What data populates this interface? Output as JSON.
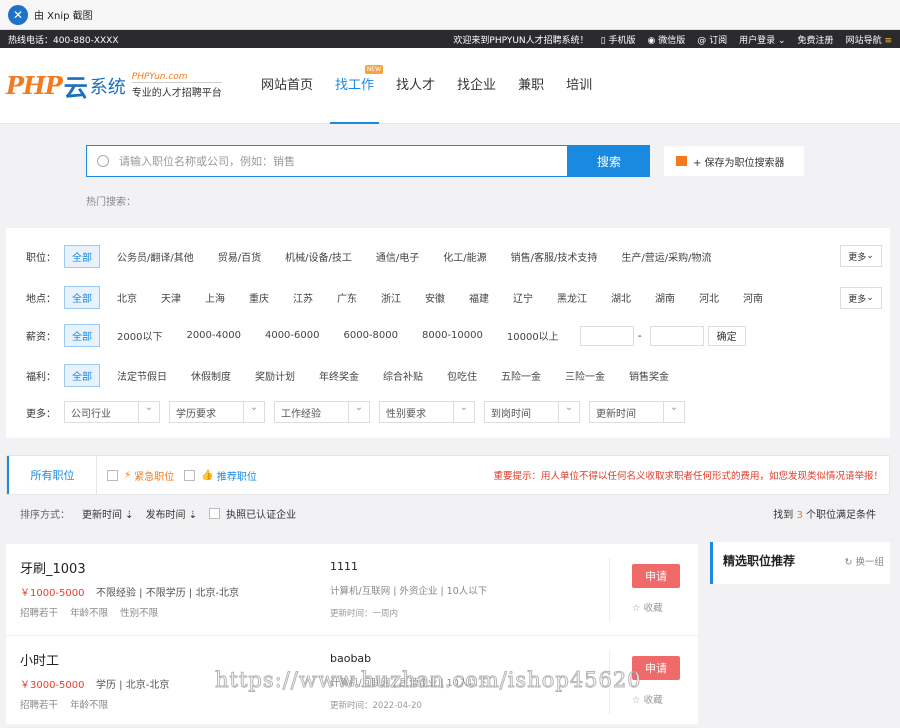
{
  "window_title": "由 Xnip 截图",
  "topbar": {
    "hotline": "热线电话：400-880-XXXX",
    "welcome": "欢迎来到PHPYUN人才招聘系统！",
    "mobile": "手机版",
    "wechat": "微信版",
    "subscribe": "订阅",
    "login": "用户登录",
    "register": "免费注册",
    "sitenav": "网站导航"
  },
  "brand": {
    "php": "PHP",
    "yun": "云",
    "xt": "系统",
    "domain": "PHPYun.com",
    "slogan": "专业的人才招聘平台"
  },
  "nav": {
    "items": [
      "网站首页",
      "找工作",
      "找人才",
      "找企业",
      "兼职",
      "培训"
    ],
    "new_badge": "NEW"
  },
  "search": {
    "placeholder": "请输入职位名称或公司，例如：销售",
    "button": "搜索",
    "save": "+ 保存为职位搜索器",
    "hot": "热门搜索："
  },
  "filters": {
    "job_label": "职位：",
    "job_opts": [
      "全部",
      "公务员/翻译/其他",
      "贸易/百货",
      "机械/设备/技工",
      "通信/电子",
      "化工/能源",
      "销售/客服/技术支持",
      "生产/营运/采购/物流"
    ],
    "loc_label": "地点：",
    "loc_opts": [
      "全部",
      "北京",
      "天津",
      "上海",
      "重庆",
      "江苏",
      "广东",
      "浙江",
      "安徽",
      "福建",
      "辽宁",
      "黑龙江",
      "湖北",
      "湖南",
      "河北",
      "河南"
    ],
    "sal_label": "薪资：",
    "sal_opts": [
      "全部",
      "2000以下",
      "2000-4000",
      "4000-6000",
      "6000-8000",
      "8000-10000",
      "10000以上"
    ],
    "sal_dash": "-",
    "confirm": "确定",
    "wel_label": "福利：",
    "wel_opts": [
      "全部",
      "法定节假日",
      "休假制度",
      "奖励计划",
      "年终奖金",
      "综合补贴",
      "包吃住",
      "五险一金",
      "三险一金",
      "销售奖金"
    ],
    "more_label": "更多：",
    "more_dd": [
      "公司行业",
      "学历要求",
      "工作经验",
      "性别要求",
      "到岗时间",
      "更新时间"
    ],
    "more_btn": "更多"
  },
  "tabs": {
    "all": "所有职位",
    "urgent": "紧急职位",
    "recommend": "推荐职位",
    "notice": "重要提示：用人单位不得以任何名义收取求职者任何形式的费用，如您发现类似情况请举报！"
  },
  "sort": {
    "label": "排序方式：",
    "update": "更新时间",
    "publish": "发布时间",
    "verified": "执照已认证企业",
    "found_pre": "找到",
    "found_n": "3",
    "found_post": "个职位满足条件"
  },
  "jobs": [
    {
      "title": "牙刷_1003",
      "salary": "￥1000-5000",
      "meta": "不限经验 | 不限学历 | 北京-北京",
      "tags": "招聘若干    年龄不限    性别不限",
      "company": "1111",
      "cinfo": "计算机/互联网 | 外资企业 | 10人以下",
      "updated": "更新时间：一周内",
      "apply": "申请",
      "fav": "收藏"
    },
    {
      "title": "小时工",
      "salary": "￥3000-5000",
      "meta": "学历 | 北京-北京",
      "tags": "招聘若干    年龄不限",
      "company": "baobab",
      "cinfo": "计算机/互联网 | 民营企业 | 10人以下",
      "updated": "更新时间：2022-04-20",
      "apply": "申请",
      "fav": "收藏"
    }
  ],
  "side": {
    "title": "精选职位推荐",
    "switch": "换一组"
  },
  "watermark": "https://www.huzhan.com/ishop45620"
}
